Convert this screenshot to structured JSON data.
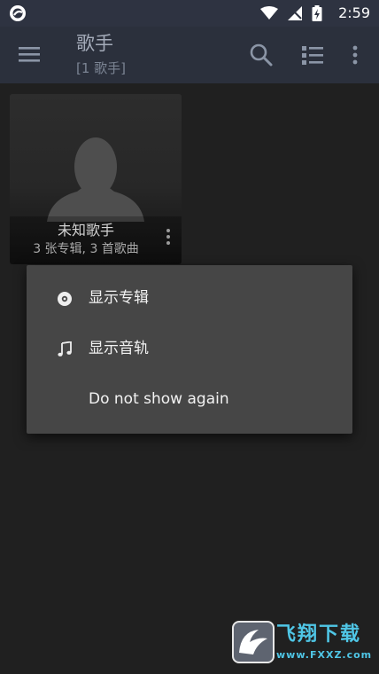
{
  "status_bar": {
    "time": "2:59",
    "app_icon": "app-circle-icon",
    "wifi_icon": "wifi-icon",
    "signal_icon": "signal-off-icon",
    "battery_icon": "battery-charging-icon"
  },
  "app_bar": {
    "title": "歌手",
    "subtitle": "[1 歌手]",
    "menu_icon": "hamburger-menu-icon",
    "search_icon": "search-icon",
    "list_icon": "list-view-icon",
    "more_icon": "more-vert-icon"
  },
  "artist_card": {
    "name": "未知歌手",
    "meta": "3 张专辑, 3 首歌曲",
    "placeholder_icon": "person-silhouette-icon",
    "more_icon": "more-vert-icon"
  },
  "popup_menu": {
    "items": [
      {
        "label": "显示专辑",
        "icon": "album-disc-icon"
      },
      {
        "label": "显示音轨",
        "icon": "music-note-icon"
      },
      {
        "label": "Do not show again",
        "icon": ""
      }
    ]
  },
  "watermark": {
    "text": "飞翔下载",
    "url": "www.FXXZ.com"
  },
  "colors": {
    "status_bar": "#2e3341",
    "app_bar": "#2b303c",
    "background": "#202020",
    "popup": "#464646",
    "watermark": "#4fc6e6"
  }
}
